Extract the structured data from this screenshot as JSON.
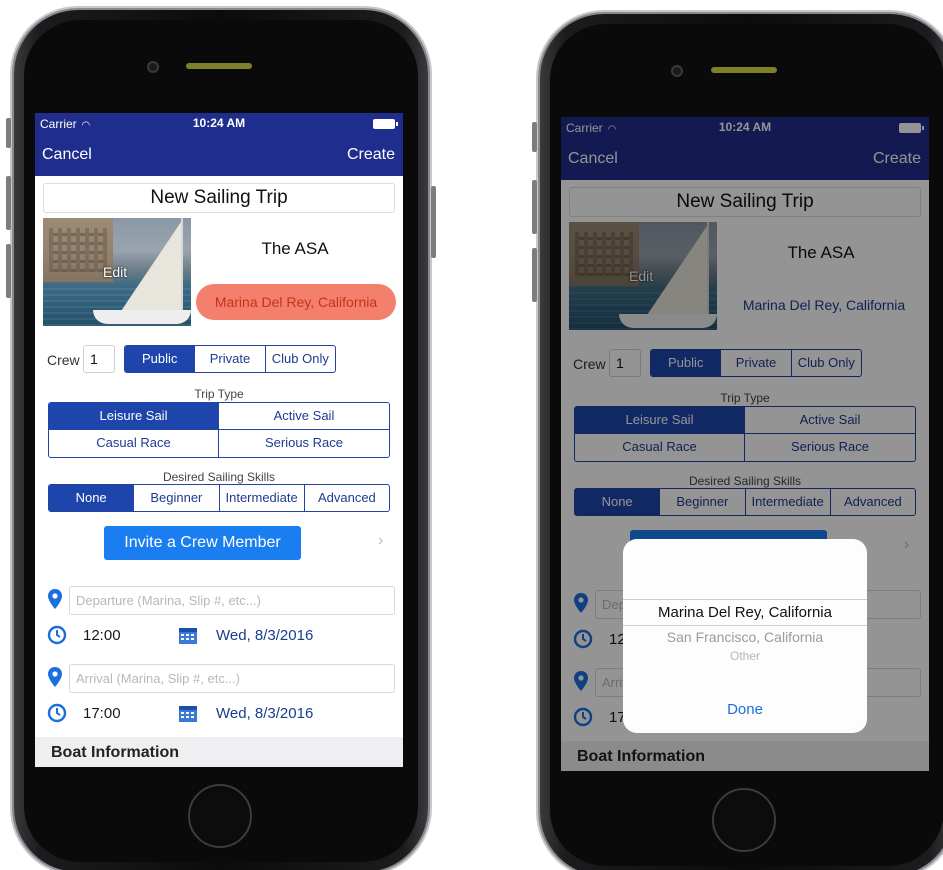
{
  "status_bar": {
    "carrier": "Carrier",
    "wifi_icon": "wifi-icon",
    "time": "10:24 AM"
  },
  "nav": {
    "cancel": "Cancel",
    "create": "Create"
  },
  "trip": {
    "title": "New Sailing Trip",
    "photo_edit": "Edit",
    "organization": "The ASA",
    "location": "Marina Del Rey, California"
  },
  "crew": {
    "label": "Crew",
    "value": "1"
  },
  "visibility": {
    "options": [
      "Public",
      "Private",
      "Club Only"
    ],
    "selected": "Public"
  },
  "trip_type": {
    "label": "Trip Type",
    "options": [
      "Leisure Sail",
      "Active Sail",
      "Casual Race",
      "Serious Race"
    ],
    "selected": "Leisure Sail"
  },
  "skills": {
    "label": "Desired Sailing Skills",
    "options": [
      "None",
      "Beginner",
      "Intermediate",
      "Advanced"
    ],
    "selected": "None"
  },
  "invite": {
    "label": "Invite a Crew Member"
  },
  "departure": {
    "placeholder": "Departure (Marina, Slip #, etc...)",
    "time": "12:00",
    "date": "Wed, 8/3/2016"
  },
  "arrival": {
    "placeholder": "Arrival (Marina, Slip #, etc...)",
    "time": "17:00",
    "date": "Wed, 8/3/2016"
  },
  "boat": {
    "section_title": "Boat Information"
  },
  "picker": {
    "options": [
      "Marina Del Rey, California",
      "San Francisco, California",
      "Other"
    ],
    "selected": "Marina Del Rey, California",
    "done": "Done"
  },
  "colors": {
    "nav_blue": "#1f2d8c",
    "segment_blue": "#1d45ac",
    "invite_blue": "#1a7ef0",
    "location_pill": "#f47f6c",
    "pin_blue": "#1a6fe0"
  }
}
